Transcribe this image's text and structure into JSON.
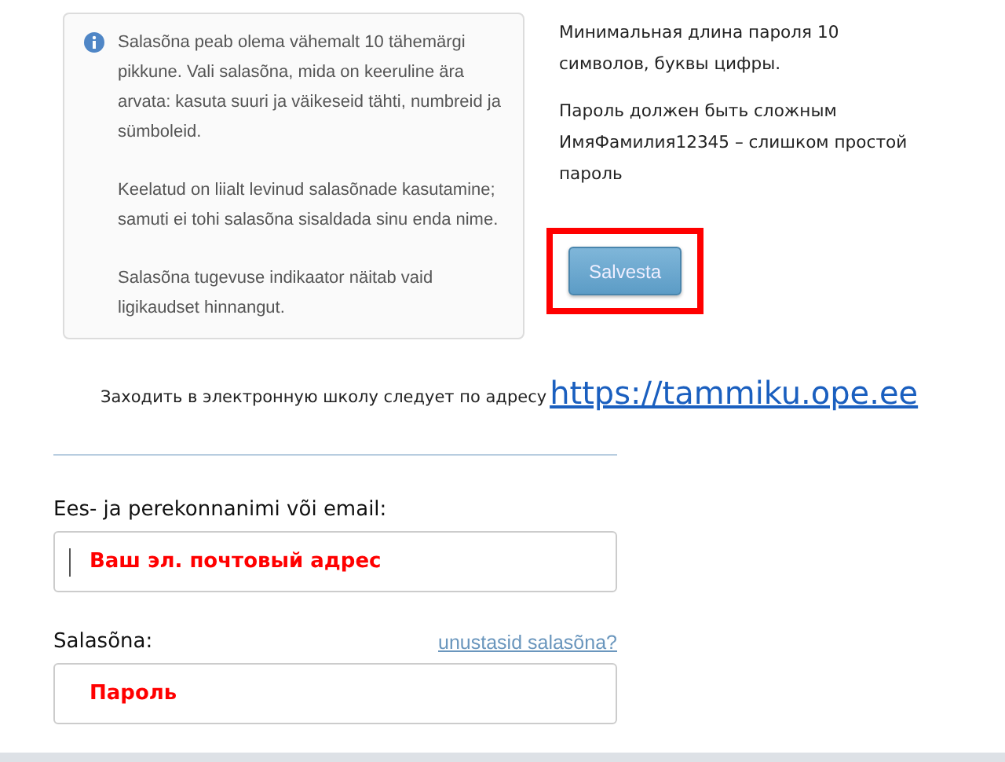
{
  "info_box": {
    "paragraphs": [
      "Salasõna peab olema vähemalt 10 tähemärgi pikkune. Vali salasõna, mida on keeruline ära arvata: kasuta suuri ja väikeseid tähti, numbreid ja sümboleid.",
      "Keelatud on liialt levinud salasõnade kasutamine; samuti ei tohi salasõna sisaldada sinu enda nime.",
      "Salasõna tugevuse indikaator näitab vaid ligikaudset hinnangut."
    ]
  },
  "notes": [
    "Минимальная длина пароля 10 символов, буквы цифры.",
    "Пароль должен быть сложным ИмяФамилия12345 – слишком простой пароль"
  ],
  "save_button": {
    "label": "Salvesta",
    "highlighted": true
  },
  "address_line": {
    "text": "Заходить в электронную школу следует по адресу",
    "link": "https://tammiku.ope.ee"
  },
  "login_form": {
    "fields": [
      {
        "label": "Ees- ja perekonnanimi või email:",
        "value": "Ваш эл. почтовый адрес",
        "focused": true
      },
      {
        "label": "Salasõna:",
        "link": "unustasid salasõna?",
        "value": "Пароль",
        "focused": false
      }
    ]
  }
}
